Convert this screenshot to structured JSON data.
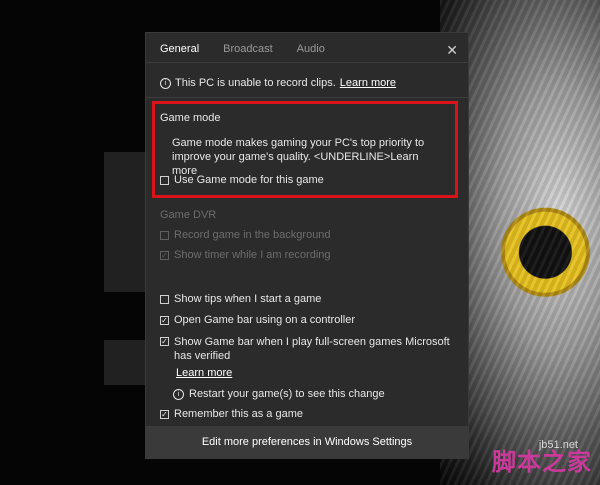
{
  "tabs": [
    "General",
    "Broadcast",
    "Audio"
  ],
  "close_glyph": "✕",
  "info": {
    "icon": "info-icon",
    "text": "This PC is unable to record clips.",
    "link": "Learn more"
  },
  "game_mode": {
    "title": "Game mode",
    "description": "Game mode makes gaming your PC's top priority to improve your game's quality. <UNDERLINE>Learn more",
    "checkbox_label": "Use Game mode for this game",
    "checked": false
  },
  "game_dvr": {
    "title": "Game DVR",
    "record_label": "Record game in the background",
    "timer_label": "Show timer while I am recording"
  },
  "options": {
    "tips_label": "Show tips when I start a game",
    "controller_label": "Open Game bar using  on a controller",
    "fullscreen_label": "Show Game bar when I play full-screen games Microsoft has verified",
    "learn_more": "Learn more",
    "restart_label": "Restart your game(s) to see this change",
    "remember_label": "Remember this as a game"
  },
  "bottom": {
    "label": "Edit more preferences in Windows Settings"
  },
  "background": {
    "watermark_text": "脚本之家",
    "watermark_url": "jb51.net",
    "accent_red": "#d8141a"
  }
}
